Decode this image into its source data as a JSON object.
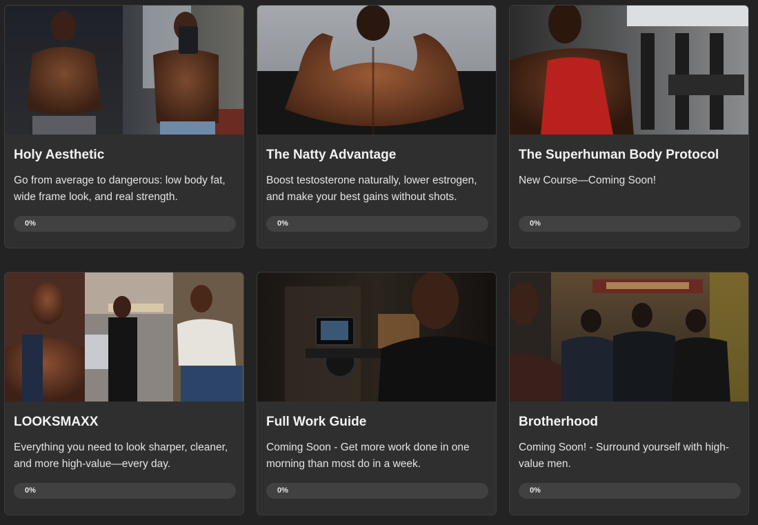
{
  "courses": [
    {
      "title": "Holy Aesthetic",
      "description": "Go from average to dangerous: low body fat, wide frame look, and real strength.",
      "progress_label": "0%",
      "progress_value": 0,
      "image": "shirtless-physique-photos"
    },
    {
      "title": "The Natty Advantage",
      "description": "Boost testosterone naturally, lower estrogen, and make your best gains without shots.",
      "progress_label": "0%",
      "progress_value": 0,
      "image": "back-double-bicep-photo"
    },
    {
      "title": "The Superhuman Body Protocol",
      "description": "New Course—Coming Soon!",
      "progress_label": "0%",
      "progress_value": 0,
      "image": "gym-tank-top-photo"
    },
    {
      "title": "LOOKSMAXX",
      "description": "Everything you need to look sharper, cleaner, and more high-value—every day.",
      "progress_label": "0%",
      "progress_value": 0,
      "image": "style-collage-photos"
    },
    {
      "title": "Full Work Guide",
      "description": "Coming Soon - Get more work done in one morning than most do in a week.",
      "progress_label": "0%",
      "progress_value": 0,
      "image": "camera-work-photo"
    },
    {
      "title": "Brotherhood",
      "description": "Coming Soon! - Surround yourself with high-value men.",
      "progress_label": "0%",
      "progress_value": 0,
      "image": "group-walking-photo"
    }
  ],
  "colors": {
    "page_background": "#232323",
    "card_background": "#2f2f2f",
    "progress_track": "#414141"
  }
}
